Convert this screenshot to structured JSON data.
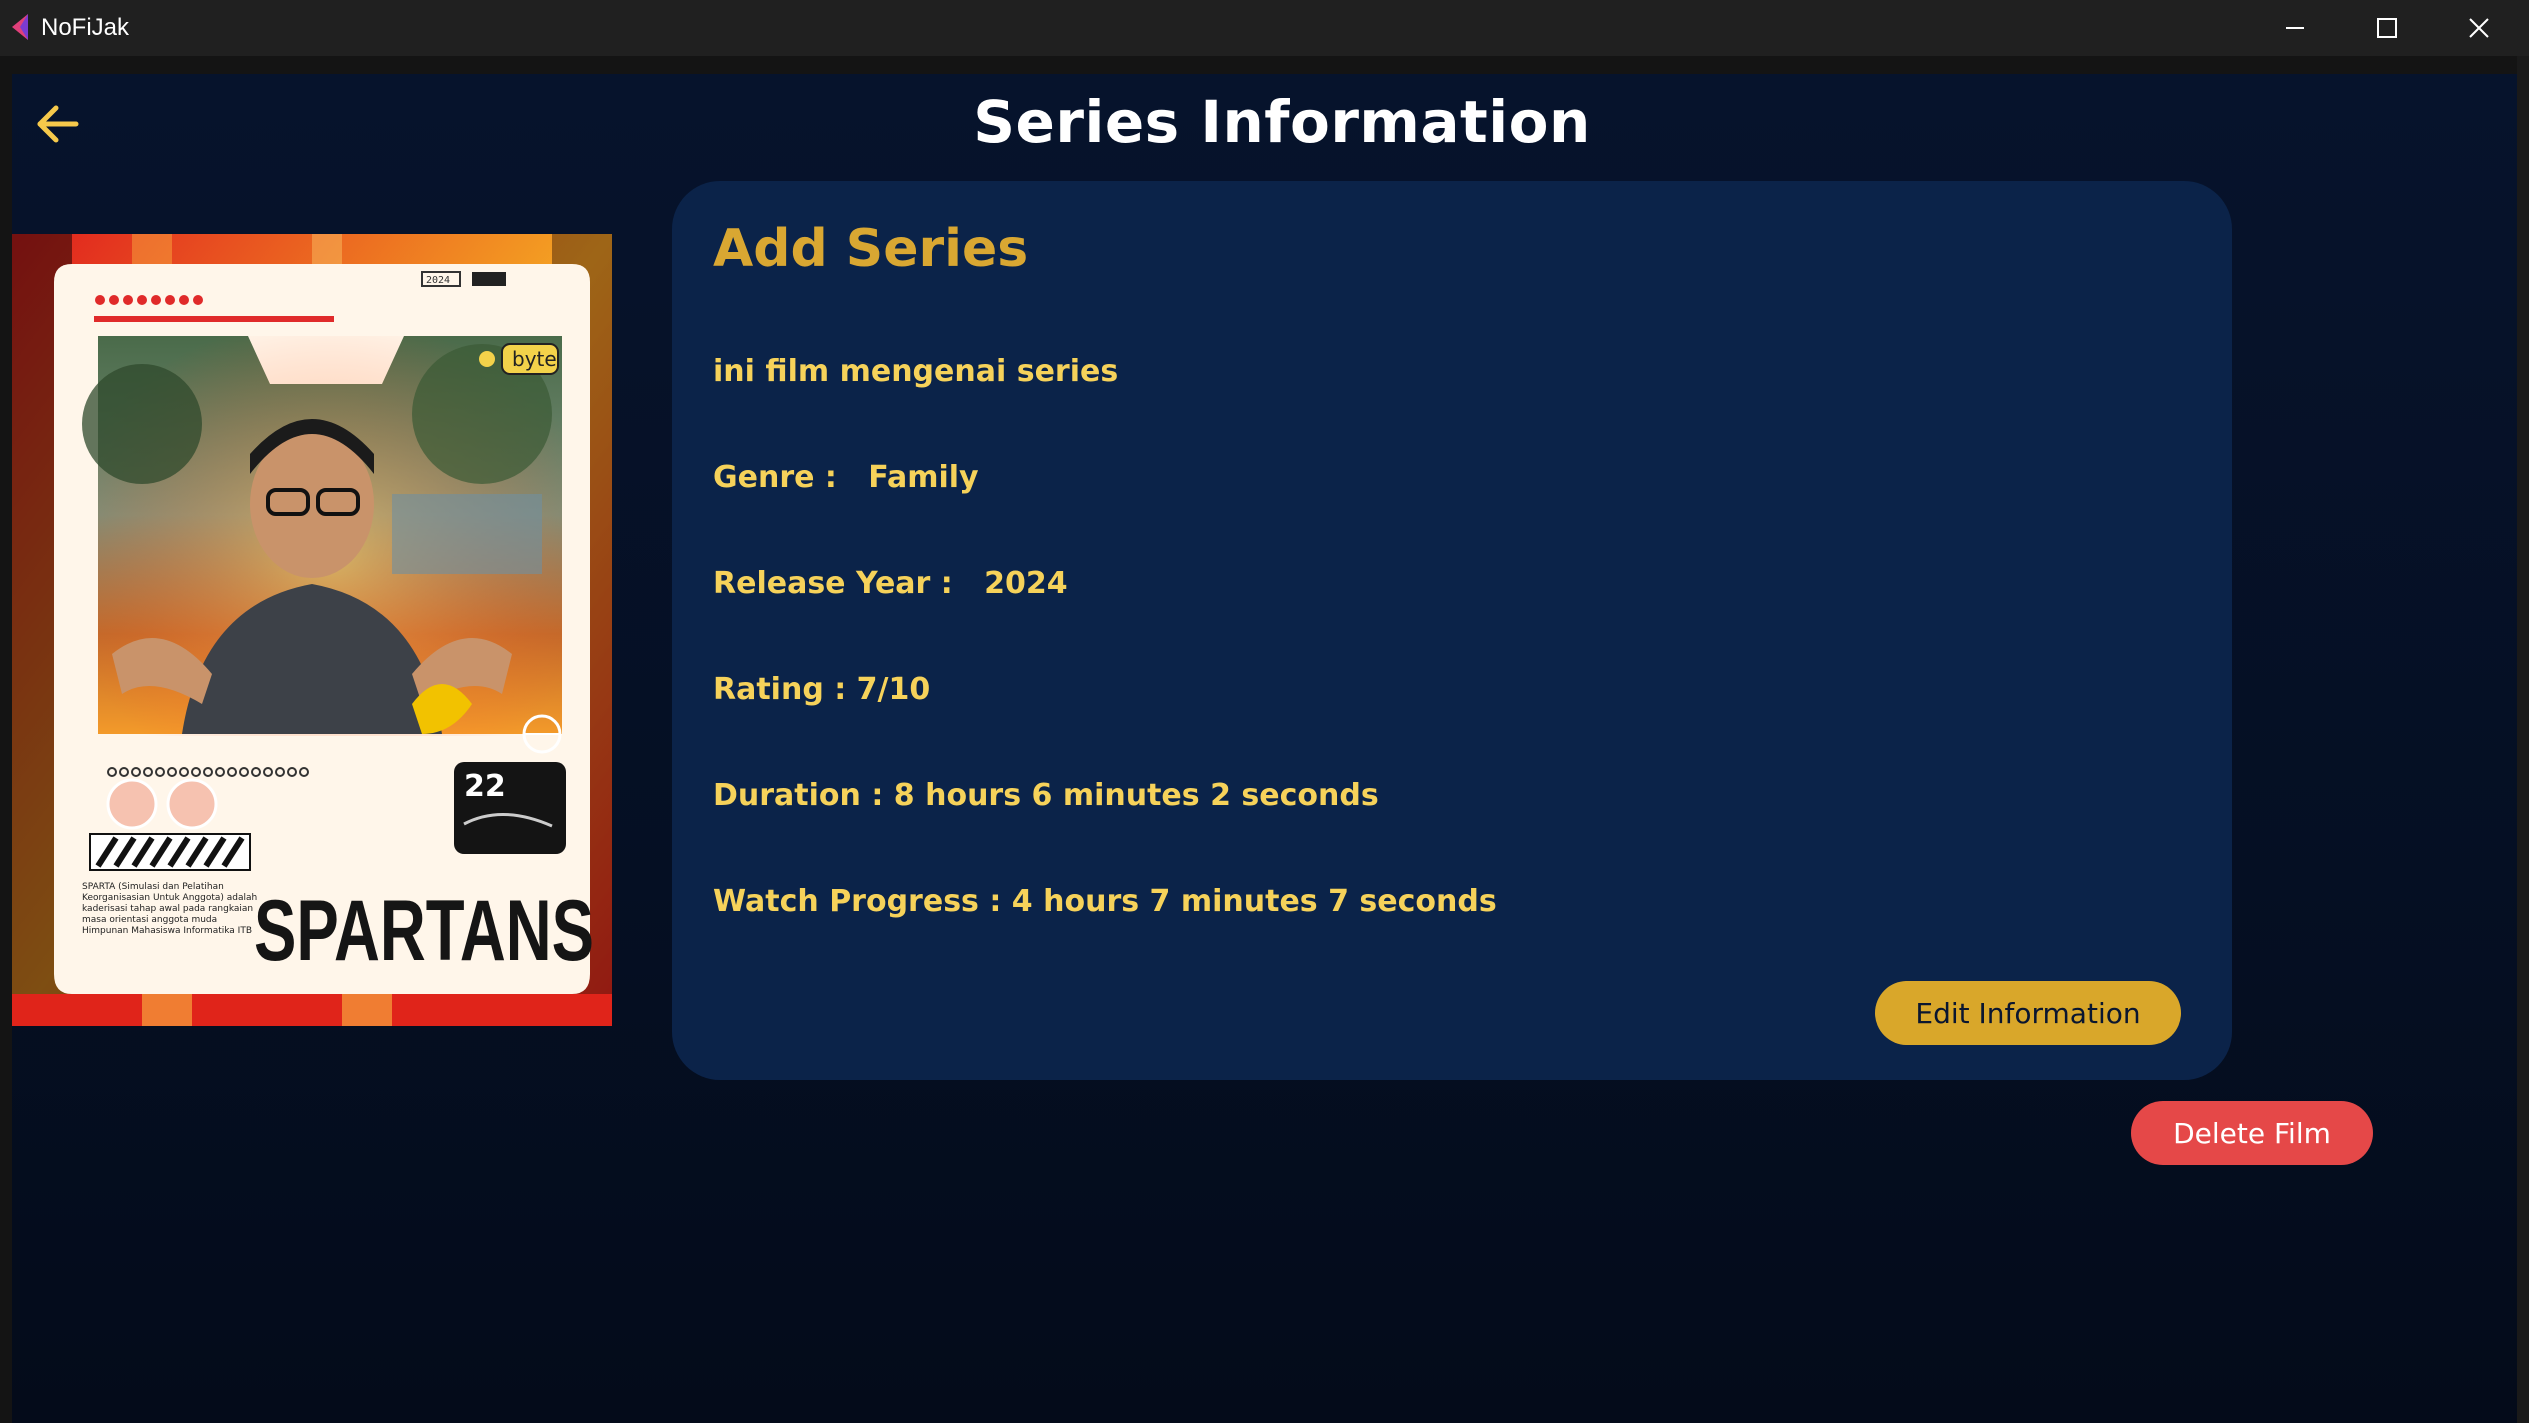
{
  "window": {
    "app_name": "NoFiJak"
  },
  "page": {
    "title": "Series Information"
  },
  "card": {
    "title": "Add Series",
    "description": "ini film mengenai series",
    "genre_line": "Genre :   Family",
    "release_year_line": "Release Year :   2024",
    "rating_line": "Rating : 7/10",
    "duration_line": "Duration : 8 hours 6 minutes 2 seconds",
    "progress_line": "Watch Progress : 4 hours 7 minutes 7 seconds",
    "edit_label": "Edit Information"
  },
  "actions": {
    "delete_label": "Delete Film"
  },
  "poster": {
    "battery_text": "2024",
    "badge_text": "byte",
    "number_text": "22",
    "brand_text": "SPARTANS",
    "blurb_text": "SPARTA (Simulasi dan Pelatihan Keorganisasian Untuk Anggota) adalah kaderisasi tahap awal pada rangkaian masa orientasi anggota muda Himpunan Mahasiswa Informatika ITB"
  },
  "colors": {
    "background": "#06132c",
    "card": "#0b2349",
    "accent_gold": "#d9a732",
    "text_gold": "#f6d25a",
    "danger": "#e54848"
  }
}
